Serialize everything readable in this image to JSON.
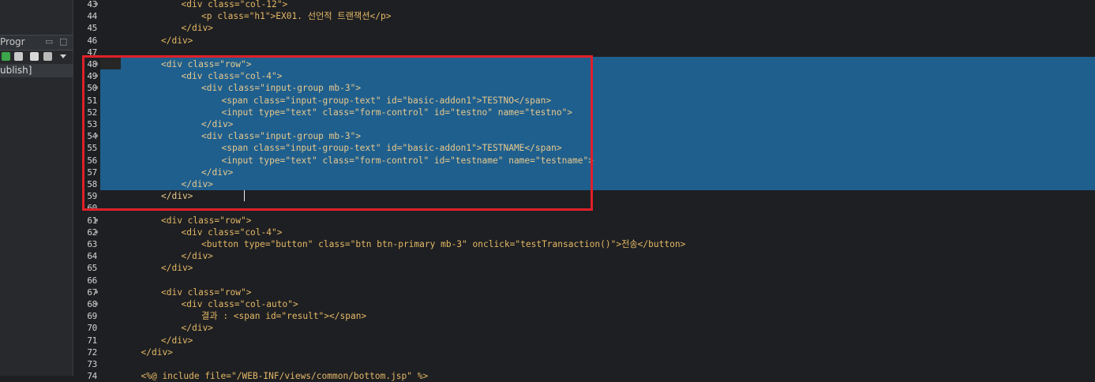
{
  "side_panel": {
    "tab_title": "Progr",
    "item_label": "ublish]",
    "window_buttons": [
      "▭",
      "□"
    ]
  },
  "editor": {
    "lines": [
      {
        "num": "43",
        "fold": true,
        "indent": 3,
        "text": "<div class=\"col-12\">"
      },
      {
        "num": "44",
        "fold": false,
        "indent": 4,
        "text": "<p class=\"h1\">EX01. 선언적 트랜잭션</p>"
      },
      {
        "num": "45",
        "fold": false,
        "indent": 3,
        "text": "</div>"
      },
      {
        "num": "46",
        "fold": false,
        "indent": 2,
        "text": "</div>"
      },
      {
        "num": "47",
        "fold": false,
        "indent": 0,
        "text": ""
      },
      {
        "num": "48",
        "fold": true,
        "indent": 2,
        "text": "<div class=\"row\">"
      },
      {
        "num": "49",
        "fold": true,
        "indent": 3,
        "text": "<div class=\"col-4\">"
      },
      {
        "num": "50",
        "fold": true,
        "indent": 4,
        "text": "<div class=\"input-group mb-3\">"
      },
      {
        "num": "51",
        "fold": false,
        "indent": 5,
        "text": "<span class=\"input-group-text\" id=\"basic-addon1\">TESTNO</span>"
      },
      {
        "num": "52",
        "fold": false,
        "indent": 5,
        "text": "<input type=\"text\" class=\"form-control\" id=\"testno\" name=\"testno\">"
      },
      {
        "num": "53",
        "fold": false,
        "indent": 4,
        "text": "</div>"
      },
      {
        "num": "54",
        "fold": true,
        "indent": 4,
        "text": "<div class=\"input-group mb-3\">"
      },
      {
        "num": "55",
        "fold": false,
        "indent": 5,
        "text": "<span class=\"input-group-text\" id=\"basic-addon1\">TESTNAME</span>"
      },
      {
        "num": "56",
        "fold": false,
        "indent": 5,
        "text": "<input type=\"text\" class=\"form-control\" id=\"testname\" name=\"testname\">"
      },
      {
        "num": "57",
        "fold": false,
        "indent": 4,
        "text": "</div>"
      },
      {
        "num": "58",
        "fold": false,
        "indent": 3,
        "text": "</div>"
      },
      {
        "num": "59",
        "fold": false,
        "indent": 2,
        "text": "</div>"
      },
      {
        "num": "60",
        "fold": false,
        "indent": 0,
        "text": ""
      },
      {
        "num": "61",
        "fold": true,
        "indent": 2,
        "text": "<div class=\"row\">"
      },
      {
        "num": "62",
        "fold": true,
        "indent": 3,
        "text": "<div class=\"col-4\">"
      },
      {
        "num": "63",
        "fold": false,
        "indent": 4,
        "text": "<button type=\"button\" class=\"btn btn-primary mb-3\" onclick=\"testTransaction()\">전송</button>"
      },
      {
        "num": "64",
        "fold": false,
        "indent": 3,
        "text": "</div>"
      },
      {
        "num": "65",
        "fold": false,
        "indent": 2,
        "text": "</div>"
      },
      {
        "num": "66",
        "fold": false,
        "indent": 0,
        "text": ""
      },
      {
        "num": "67",
        "fold": true,
        "indent": 2,
        "text": "<div class=\"row\">"
      },
      {
        "num": "68",
        "fold": true,
        "indent": 3,
        "text": "<div class=\"col-auto\">"
      },
      {
        "num": "69",
        "fold": false,
        "indent": 4,
        "text": "결과 : <span id=\"result\"></span>"
      },
      {
        "num": "70",
        "fold": false,
        "indent": 3,
        "text": "</div>"
      },
      {
        "num": "71",
        "fold": false,
        "indent": 2,
        "text": "</div>"
      },
      {
        "num": "72",
        "fold": false,
        "indent": 1,
        "text": "</div>"
      },
      {
        "num": "73",
        "fold": false,
        "indent": 0,
        "text": ""
      },
      {
        "num": "74",
        "fold": false,
        "indent": 1,
        "text": "<%@ include file=\"/WEB-INF/views/common/bottom.jsp\" %>"
      }
    ],
    "selection": {
      "from": "48",
      "to": "59"
    },
    "highlight_color": "#e0202a",
    "selection_color": "#1f5f8e"
  }
}
